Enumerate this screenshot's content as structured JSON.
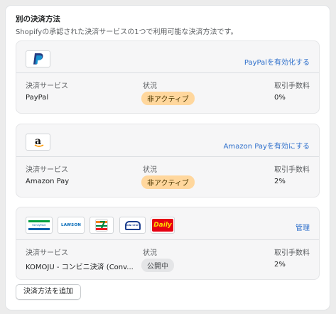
{
  "section": {
    "title": "別の決済方法",
    "subtitle": "Shopifyの承認された決済サービスの1つで利用可能な決済方法です。"
  },
  "columns": {
    "provider": "決済サービス",
    "status": "状況",
    "fee": "取引手数料"
  },
  "providers": [
    {
      "logo_icon": "paypal-logo-icon",
      "action": "PayPalを有効化する",
      "name": "PayPal",
      "status": "非アクティブ",
      "fee": "0%"
    },
    {
      "logo_icon": "amazon-logo-icon",
      "logo_text": "a",
      "action": "Amazon Payを有効にする",
      "name": "Amazon Pay",
      "status": "非アクティブ",
      "fee": "2%"
    },
    {
      "logos": [
        {
          "icon": "familymart-logo-icon",
          "text": "FamilyMart"
        },
        {
          "icon": "lawson-logo-icon",
          "text": "LAWSON"
        },
        {
          "icon": "seven-eleven-logo-icon",
          "text": "7"
        },
        {
          "icon": "ministop-logo-icon",
          "text": "MINI STOP"
        },
        {
          "icon": "daily-yamazaki-logo-icon",
          "text": "Daily"
        }
      ],
      "action": "管理",
      "name": "KOMOJU - コンビニ決済 (Conv...",
      "status": "公開中",
      "fee": "2%"
    }
  ],
  "add_button": "決済方法を追加",
  "colors": {
    "link": "#2c6ecb",
    "badge_inactive_bg": "#ffd79d",
    "badge_public_bg": "#e4e5e7"
  }
}
